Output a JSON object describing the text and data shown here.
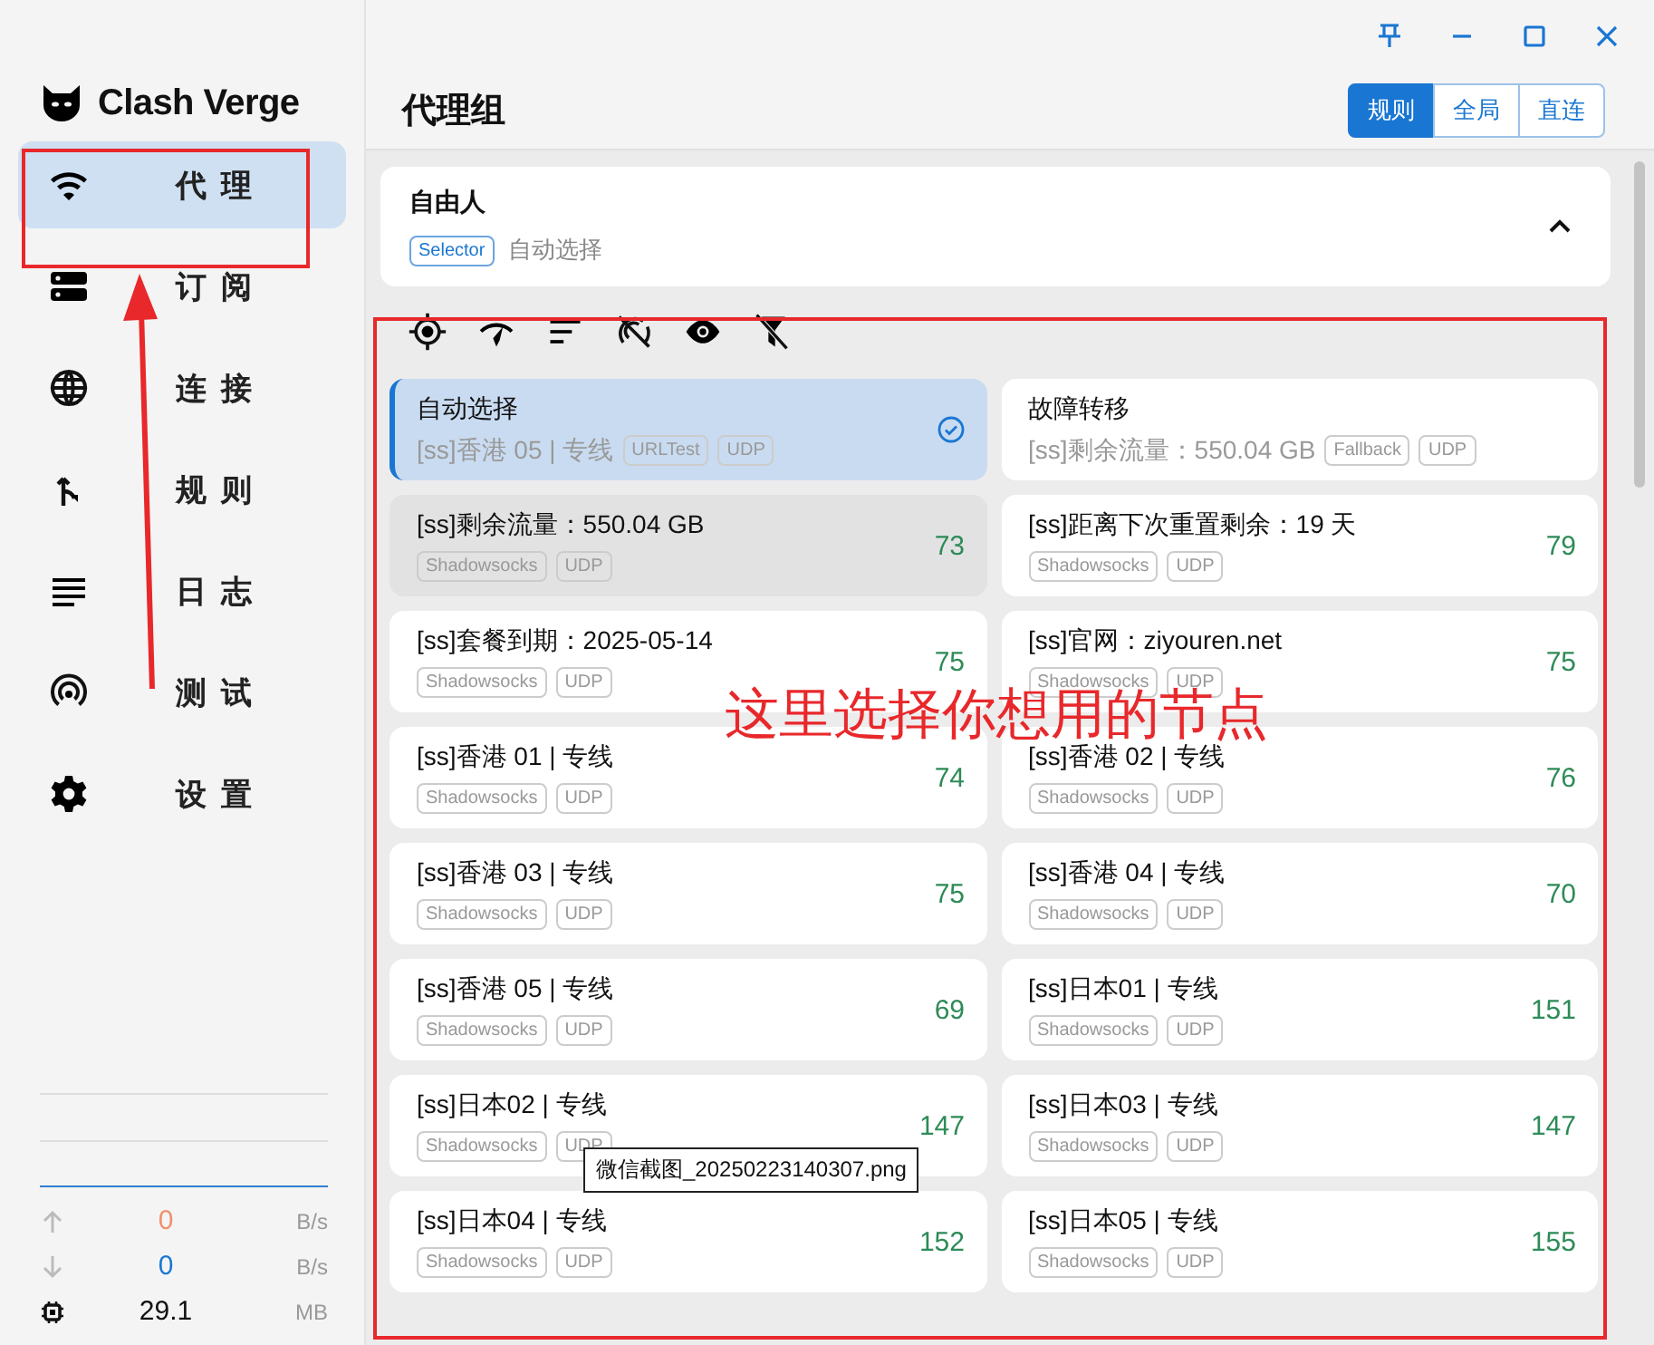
{
  "app": {
    "name": "Clash Verge"
  },
  "nav": [
    {
      "label": "代理",
      "selected": true
    },
    {
      "label": "订阅",
      "selected": false
    },
    {
      "label": "连接",
      "selected": false
    },
    {
      "label": "规则",
      "selected": false
    },
    {
      "label": "日志",
      "selected": false
    },
    {
      "label": "测试",
      "selected": false
    },
    {
      "label": "设置",
      "selected": false
    }
  ],
  "stats": [
    {
      "kind": "upload",
      "value": "0",
      "unit": "B/s"
    },
    {
      "kind": "download",
      "value": "0",
      "unit": "B/s"
    },
    {
      "kind": "memory",
      "value": "29.1",
      "unit": "MB"
    }
  ],
  "page": {
    "title": "代理组"
  },
  "modes": [
    {
      "label": "规则",
      "selected": true
    },
    {
      "label": "全局",
      "selected": false
    },
    {
      "label": "直连",
      "selected": false
    }
  ],
  "group": {
    "name": "自由人",
    "type": "Selector",
    "current": "自动选择",
    "expanded": true
  },
  "proxies": [
    {
      "kind": "group",
      "name": "自动选择",
      "detail": "[ss]香港 05 | 专线",
      "tags": [
        "URLTest",
        "UDP"
      ],
      "selected": true,
      "hovered": false
    },
    {
      "kind": "group",
      "name": "故障转移",
      "detail": "[ss]剩余流量：550.04 GB",
      "tags": [
        "Fallback",
        "UDP"
      ],
      "selected": false,
      "hovered": false
    },
    {
      "kind": "node",
      "name": "[ss]剩余流量：550.04 GB",
      "tags": [
        "Shadowsocks",
        "UDP"
      ],
      "delay": "73",
      "selected": false,
      "hovered": true
    },
    {
      "kind": "node",
      "name": "[ss]距离下次重置剩余：19 天",
      "tags": [
        "Shadowsocks",
        "UDP"
      ],
      "delay": "79",
      "selected": false,
      "hovered": false
    },
    {
      "kind": "node",
      "name": "[ss]套餐到期：2025-05-14",
      "tags": [
        "Shadowsocks",
        "UDP"
      ],
      "delay": "75",
      "selected": false,
      "hovered": false
    },
    {
      "kind": "node",
      "name": "[ss]官网：ziyouren.net",
      "tags": [
        "Shadowsocks",
        "UDP"
      ],
      "delay": "75",
      "selected": false,
      "hovered": false
    },
    {
      "kind": "node",
      "name": "[ss]香港 01 | 专线",
      "tags": [
        "Shadowsocks",
        "UDP"
      ],
      "delay": "74",
      "selected": false,
      "hovered": false
    },
    {
      "kind": "node",
      "name": "[ss]香港 02 | 专线",
      "tags": [
        "Shadowsocks",
        "UDP"
      ],
      "delay": "76",
      "selected": false,
      "hovered": false
    },
    {
      "kind": "node",
      "name": "[ss]香港 03 | 专线",
      "tags": [
        "Shadowsocks",
        "UDP"
      ],
      "delay": "75",
      "selected": false,
      "hovered": false
    },
    {
      "kind": "node",
      "name": "[ss]香港 04 | 专线",
      "tags": [
        "Shadowsocks",
        "UDP"
      ],
      "delay": "70",
      "selected": false,
      "hovered": false
    },
    {
      "kind": "node",
      "name": "[ss]香港 05 | 专线",
      "tags": [
        "Shadowsocks",
        "UDP"
      ],
      "delay": "69",
      "selected": false,
      "hovered": false
    },
    {
      "kind": "node",
      "name": "[ss]日本01 | 专线",
      "tags": [
        "Shadowsocks",
        "UDP"
      ],
      "delay": "151",
      "selected": false,
      "hovered": false
    },
    {
      "kind": "node",
      "name": "[ss]日本02 | 专线",
      "tags": [
        "Shadowsocks",
        "UDP"
      ],
      "delay": "147",
      "selected": false,
      "hovered": false
    },
    {
      "kind": "node",
      "name": "[ss]日本03 | 专线",
      "tags": [
        "Shadowsocks",
        "UDP"
      ],
      "delay": "147",
      "selected": false,
      "hovered": false
    },
    {
      "kind": "node",
      "name": "[ss]日本04 | 专线",
      "tags": [
        "Shadowsocks",
        "UDP"
      ],
      "delay": "152",
      "selected": false,
      "hovered": false
    },
    {
      "kind": "node",
      "name": "[ss]日本05 | 专线",
      "tags": [
        "Shadowsocks",
        "UDP"
      ],
      "delay": "155",
      "selected": false,
      "hovered": false
    }
  ],
  "annotation": {
    "note": "这里选择你想用的节点"
  },
  "tooltip": {
    "text": "微信截图_20250223140307.png"
  }
}
